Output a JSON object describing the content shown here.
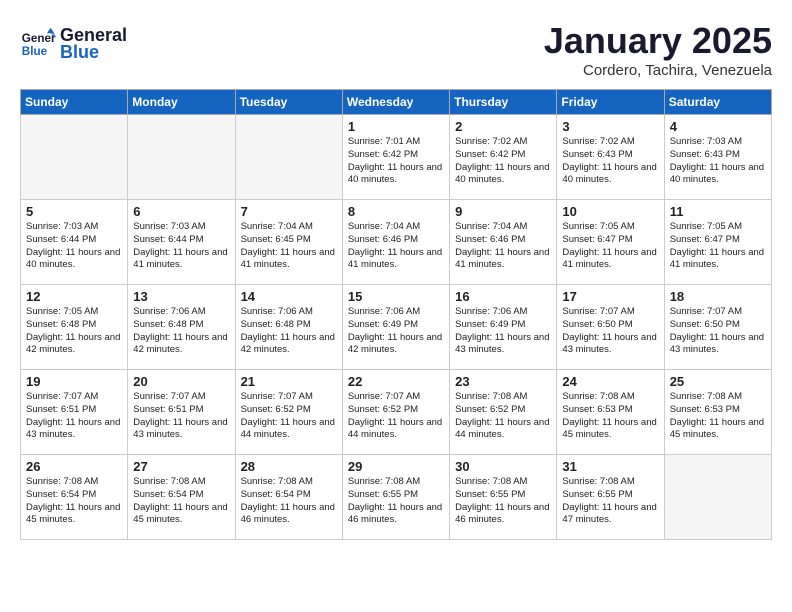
{
  "header": {
    "logo_line1": "General",
    "logo_line2": "Blue",
    "month": "January 2025",
    "location": "Cordero, Tachira, Venezuela"
  },
  "weekdays": [
    "Sunday",
    "Monday",
    "Tuesday",
    "Wednesday",
    "Thursday",
    "Friday",
    "Saturday"
  ],
  "weeks": [
    [
      {
        "day": "",
        "info": ""
      },
      {
        "day": "",
        "info": ""
      },
      {
        "day": "",
        "info": ""
      },
      {
        "day": "1",
        "info": "Sunrise: 7:01 AM\nSunset: 6:42 PM\nDaylight: 11 hours and 40 minutes."
      },
      {
        "day": "2",
        "info": "Sunrise: 7:02 AM\nSunset: 6:42 PM\nDaylight: 11 hours and 40 minutes."
      },
      {
        "day": "3",
        "info": "Sunrise: 7:02 AM\nSunset: 6:43 PM\nDaylight: 11 hours and 40 minutes."
      },
      {
        "day": "4",
        "info": "Sunrise: 7:03 AM\nSunset: 6:43 PM\nDaylight: 11 hours and 40 minutes."
      }
    ],
    [
      {
        "day": "5",
        "info": "Sunrise: 7:03 AM\nSunset: 6:44 PM\nDaylight: 11 hours and 40 minutes."
      },
      {
        "day": "6",
        "info": "Sunrise: 7:03 AM\nSunset: 6:44 PM\nDaylight: 11 hours and 41 minutes."
      },
      {
        "day": "7",
        "info": "Sunrise: 7:04 AM\nSunset: 6:45 PM\nDaylight: 11 hours and 41 minutes."
      },
      {
        "day": "8",
        "info": "Sunrise: 7:04 AM\nSunset: 6:46 PM\nDaylight: 11 hours and 41 minutes."
      },
      {
        "day": "9",
        "info": "Sunrise: 7:04 AM\nSunset: 6:46 PM\nDaylight: 11 hours and 41 minutes."
      },
      {
        "day": "10",
        "info": "Sunrise: 7:05 AM\nSunset: 6:47 PM\nDaylight: 11 hours and 41 minutes."
      },
      {
        "day": "11",
        "info": "Sunrise: 7:05 AM\nSunset: 6:47 PM\nDaylight: 11 hours and 41 minutes."
      }
    ],
    [
      {
        "day": "12",
        "info": "Sunrise: 7:05 AM\nSunset: 6:48 PM\nDaylight: 11 hours and 42 minutes."
      },
      {
        "day": "13",
        "info": "Sunrise: 7:06 AM\nSunset: 6:48 PM\nDaylight: 11 hours and 42 minutes."
      },
      {
        "day": "14",
        "info": "Sunrise: 7:06 AM\nSunset: 6:48 PM\nDaylight: 11 hours and 42 minutes."
      },
      {
        "day": "15",
        "info": "Sunrise: 7:06 AM\nSunset: 6:49 PM\nDaylight: 11 hours and 42 minutes."
      },
      {
        "day": "16",
        "info": "Sunrise: 7:06 AM\nSunset: 6:49 PM\nDaylight: 11 hours and 43 minutes."
      },
      {
        "day": "17",
        "info": "Sunrise: 7:07 AM\nSunset: 6:50 PM\nDaylight: 11 hours and 43 minutes."
      },
      {
        "day": "18",
        "info": "Sunrise: 7:07 AM\nSunset: 6:50 PM\nDaylight: 11 hours and 43 minutes."
      }
    ],
    [
      {
        "day": "19",
        "info": "Sunrise: 7:07 AM\nSunset: 6:51 PM\nDaylight: 11 hours and 43 minutes."
      },
      {
        "day": "20",
        "info": "Sunrise: 7:07 AM\nSunset: 6:51 PM\nDaylight: 11 hours and 43 minutes."
      },
      {
        "day": "21",
        "info": "Sunrise: 7:07 AM\nSunset: 6:52 PM\nDaylight: 11 hours and 44 minutes."
      },
      {
        "day": "22",
        "info": "Sunrise: 7:07 AM\nSunset: 6:52 PM\nDaylight: 11 hours and 44 minutes."
      },
      {
        "day": "23",
        "info": "Sunrise: 7:08 AM\nSunset: 6:52 PM\nDaylight: 11 hours and 44 minutes."
      },
      {
        "day": "24",
        "info": "Sunrise: 7:08 AM\nSunset: 6:53 PM\nDaylight: 11 hours and 45 minutes."
      },
      {
        "day": "25",
        "info": "Sunrise: 7:08 AM\nSunset: 6:53 PM\nDaylight: 11 hours and 45 minutes."
      }
    ],
    [
      {
        "day": "26",
        "info": "Sunrise: 7:08 AM\nSunset: 6:54 PM\nDaylight: 11 hours and 45 minutes."
      },
      {
        "day": "27",
        "info": "Sunrise: 7:08 AM\nSunset: 6:54 PM\nDaylight: 11 hours and 45 minutes."
      },
      {
        "day": "28",
        "info": "Sunrise: 7:08 AM\nSunset: 6:54 PM\nDaylight: 11 hours and 46 minutes."
      },
      {
        "day": "29",
        "info": "Sunrise: 7:08 AM\nSunset: 6:55 PM\nDaylight: 11 hours and 46 minutes."
      },
      {
        "day": "30",
        "info": "Sunrise: 7:08 AM\nSunset: 6:55 PM\nDaylight: 11 hours and 46 minutes."
      },
      {
        "day": "31",
        "info": "Sunrise: 7:08 AM\nSunset: 6:55 PM\nDaylight: 11 hours and 47 minutes."
      },
      {
        "day": "",
        "info": ""
      }
    ]
  ]
}
